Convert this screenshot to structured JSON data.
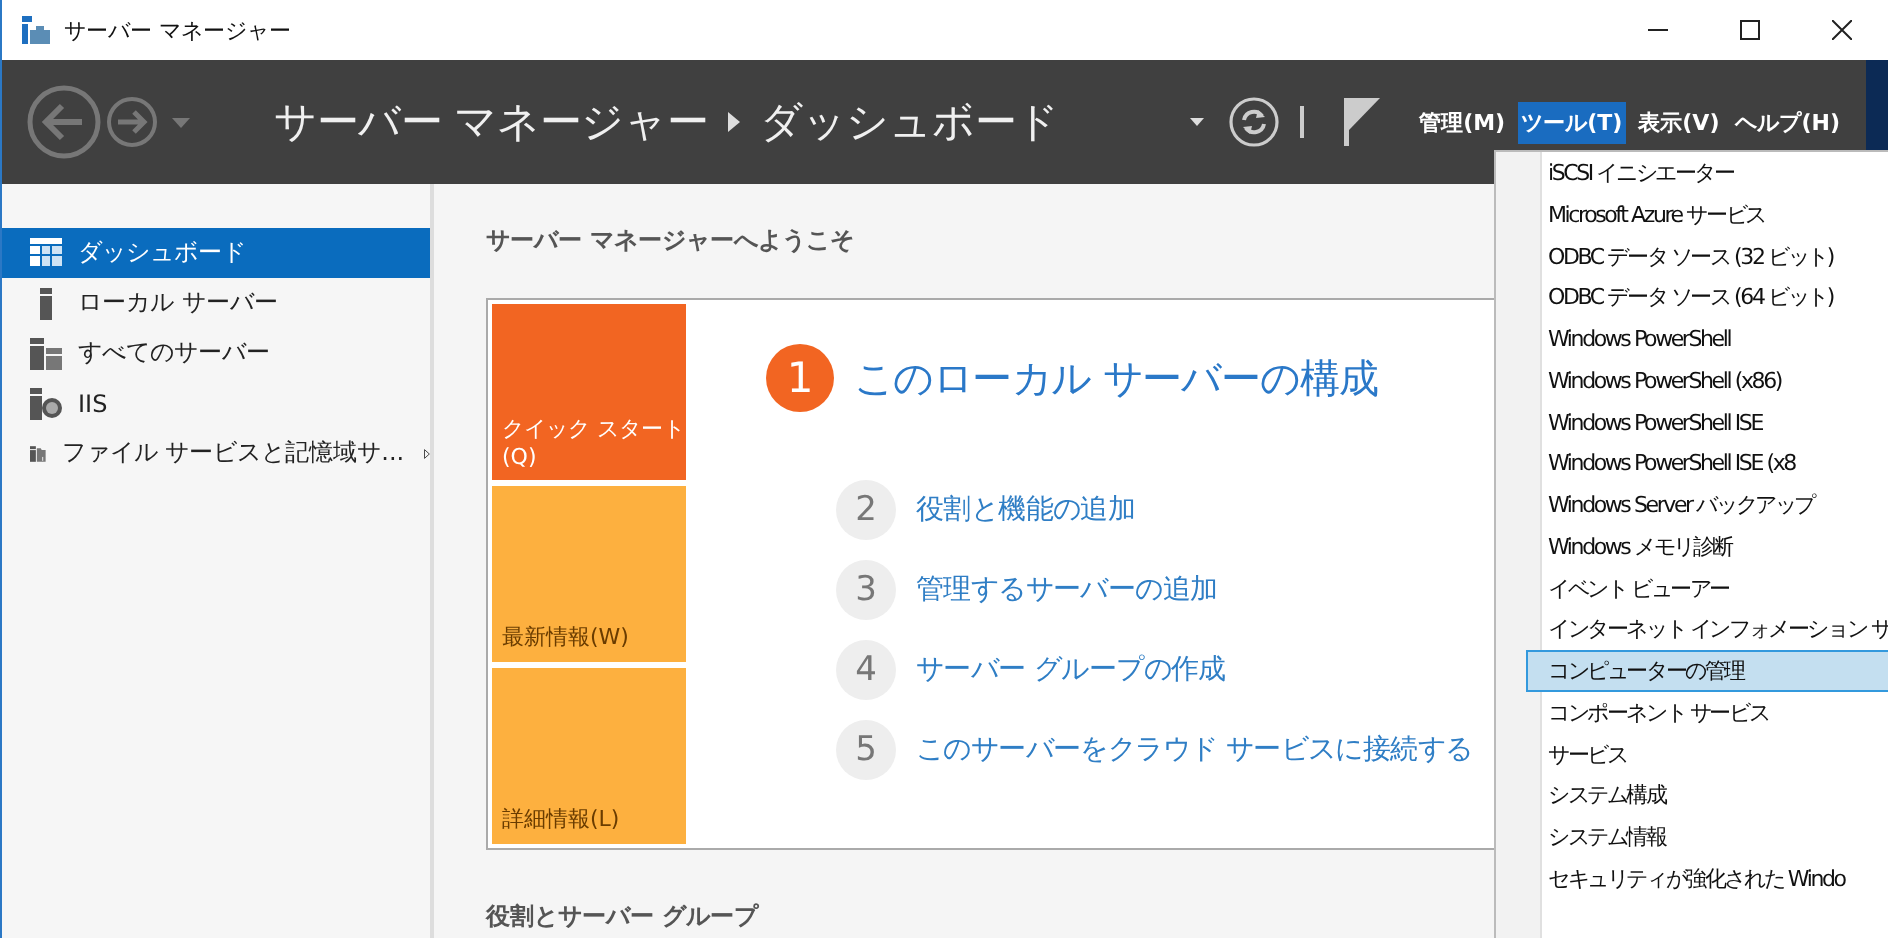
{
  "window": {
    "title": "サーバー マネージャー"
  },
  "header": {
    "breadcrumb": [
      "サーバー マネージャー",
      "ダッシュボード"
    ],
    "menus": [
      {
        "label": "管理(M)",
        "selected": false
      },
      {
        "label": "ツール(T)",
        "selected": true
      },
      {
        "label": "表示(V)",
        "selected": false
      },
      {
        "label": "ヘルプ(H)",
        "selected": false
      }
    ]
  },
  "sidebar": {
    "items": [
      {
        "label": "ダッシュボード",
        "selected": true,
        "has_submenu": false
      },
      {
        "label": "ローカル サーバー",
        "selected": false,
        "has_submenu": false
      },
      {
        "label": "すべてのサーバー",
        "selected": false,
        "has_submenu": false
      },
      {
        "label": "IIS",
        "selected": false,
        "has_submenu": false
      },
      {
        "label": "ファイル サービスと記憶域サ...",
        "selected": false,
        "has_submenu": true
      }
    ]
  },
  "welcome": {
    "heading": "サーバー マネージャーへようこそ",
    "tiles": [
      {
        "label": "クイック スタート(Q)",
        "kind": "primary"
      },
      {
        "label": "最新情報(W)",
        "kind": "secondary"
      },
      {
        "label": "詳細情報(L)",
        "kind": "secondary"
      }
    ],
    "steps": [
      {
        "number": "1",
        "text": "このローカル サーバーの構成",
        "kind": "primary"
      },
      {
        "number": "2",
        "text": "役割と機能の追加",
        "kind": "secondary"
      },
      {
        "number": "3",
        "text": "管理するサーバーの追加",
        "kind": "secondary"
      },
      {
        "number": "4",
        "text": "サーバー グループの作成",
        "kind": "secondary"
      },
      {
        "number": "5",
        "text": "このサーバーをクラウド サービスに接続する",
        "kind": "secondary"
      }
    ]
  },
  "next_section": {
    "heading": "役割とサーバー グループ"
  },
  "tools_menu": {
    "items": [
      {
        "label": "iSCSI イニシエーター",
        "selected": false
      },
      {
        "label": "Microsoft Azure サービス",
        "selected": false
      },
      {
        "label": "ODBC データ ソース (32 ビット)",
        "selected": false
      },
      {
        "label": "ODBC データ ソース (64 ビット)",
        "selected": false
      },
      {
        "label": "Windows PowerShell",
        "selected": false
      },
      {
        "label": "Windows PowerShell (x86)",
        "selected": false
      },
      {
        "label": "Windows PowerShell ISE",
        "selected": false
      },
      {
        "label": "Windows PowerShell ISE (x8",
        "selected": false
      },
      {
        "label": "Windows Server バックアップ",
        "selected": false
      },
      {
        "label": "Windows メモリ診断",
        "selected": false
      },
      {
        "label": "イベント ビューアー",
        "selected": false
      },
      {
        "label": "インターネット インフォメーション サ",
        "selected": false
      },
      {
        "label": "コンピューターの管理",
        "selected": true
      },
      {
        "label": "コンポーネント サービス",
        "selected": false
      },
      {
        "label": "サービス",
        "selected": false
      },
      {
        "label": "システム構成",
        "selected": false
      },
      {
        "label": "システム情報",
        "selected": false
      },
      {
        "label": "セキュリティが強化された Windo",
        "selected": false
      }
    ]
  }
}
